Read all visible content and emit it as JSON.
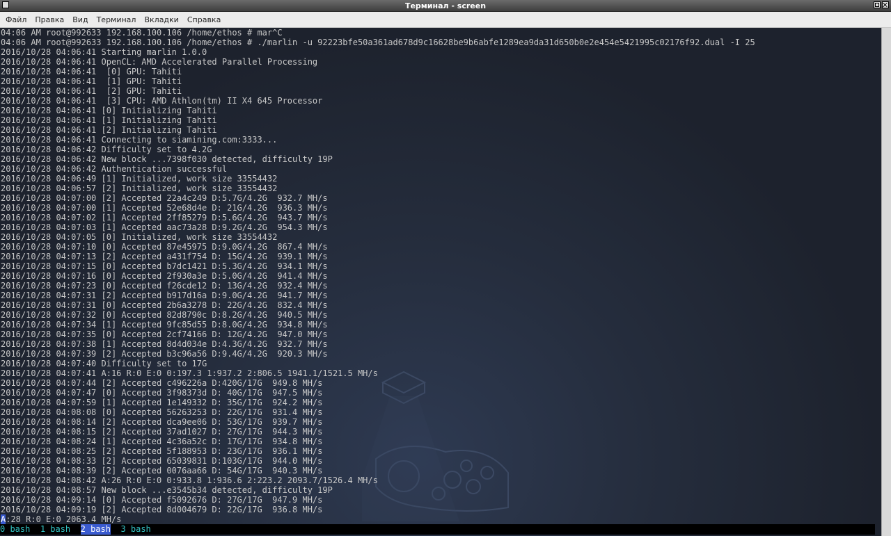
{
  "window": {
    "title": "Терминал - screen"
  },
  "menu": [
    "Файл",
    "Правка",
    "Вид",
    "Терминал",
    "Вкладки",
    "Справка"
  ],
  "terminal": {
    "lines": [
      "04:06 AM root@992633 192.168.100.106 /home/ethos # mar^C",
      "04:06 AM root@992633 192.168.100.106 /home/ethos # ./marlin -u 92223bfe50a361ad678d9c16628be9b6abfe1289ea9da31d650b0e2e454e5421995c02176f92.dual -I 25",
      "2016/10/28 04:06:41 Starting marlin 1.0.0",
      "2016/10/28 04:06:41 OpenCL: AMD Accelerated Parallel Processing",
      "2016/10/28 04:06:41  [0] GPU: Tahiti",
      "2016/10/28 04:06:41  [1] GPU: Tahiti",
      "2016/10/28 04:06:41  [2] GPU: Tahiti",
      "2016/10/28 04:06:41  [3] CPU: AMD Athlon(tm) II X4 645 Processor",
      "2016/10/28 04:06:41 [0] Initializing Tahiti",
      "2016/10/28 04:06:41 [1] Initializing Tahiti",
      "2016/10/28 04:06:41 [2] Initializing Tahiti",
      "2016/10/28 04:06:41 Connecting to siamining.com:3333...",
      "2016/10/28 04:06:42 Difficulty set to 4.2G",
      "2016/10/28 04:06:42 New block ...7398f030 detected, difficulty 19P",
      "2016/10/28 04:06:42 Authentication successful",
      "2016/10/28 04:06:49 [1] Initialized, work size 33554432",
      "2016/10/28 04:06:57 [2] Initialized, work size 33554432",
      "2016/10/28 04:07:00 [2] Accepted 22a4c249 D:5.7G/4.2G  932.7 MH/s",
      "2016/10/28 04:07:00 [1] Accepted 52e68d4e D: 21G/4.2G  936.3 MH/s",
      "2016/10/28 04:07:02 [1] Accepted 2ff85279 D:5.6G/4.2G  943.7 MH/s",
      "2016/10/28 04:07:03 [1] Accepted aac73a28 D:9.2G/4.2G  954.3 MH/s",
      "2016/10/28 04:07:05 [0] Initialized, work size 33554432",
      "2016/10/28 04:07:10 [0] Accepted 87e45975 D:9.0G/4.2G  867.4 MH/s",
      "2016/10/28 04:07:13 [2] Accepted a431f754 D: 15G/4.2G  939.1 MH/s",
      "2016/10/28 04:07:15 [0] Accepted b7dc1421 D:5.3G/4.2G  934.1 MH/s",
      "2016/10/28 04:07:16 [0] Accepted 2f930a3e D:5.0G/4.2G  941.4 MH/s",
      "2016/10/28 04:07:23 [0] Accepted f26cde12 D: 13G/4.2G  932.4 MH/s",
      "2016/10/28 04:07:31 [2] Accepted b917d16a D:9.0G/4.2G  941.7 MH/s",
      "2016/10/28 04:07:31 [0] Accepted 2b6a3278 D: 22G/4.2G  832.4 MH/s",
      "2016/10/28 04:07:32 [0] Accepted 82d8790c D:8.2G/4.2G  940.5 MH/s",
      "2016/10/28 04:07:34 [1] Accepted 9fc85d55 D:8.0G/4.2G  934.8 MH/s",
      "2016/10/28 04:07:35 [0] Accepted 2cf74166 D: 12G/4.2G  947.0 MH/s",
      "2016/10/28 04:07:38 [1] Accepted 8d4d034e D:4.3G/4.2G  932.7 MH/s",
      "2016/10/28 04:07:39 [2] Accepted b3c96a56 D:9.4G/4.2G  920.3 MH/s",
      "2016/10/28 04:07:40 Difficulty set to 17G",
      "2016/10/28 04:07:41 A:16 R:0 E:0 0:197.3 1:937.2 2:806.5 1941.1/1521.5 MH/s",
      "2016/10/28 04:07:44 [2] Accepted c496226a D:420G/17G  949.8 MH/s",
      "2016/10/28 04:07:47 [0] Accepted 3f98373d D: 40G/17G  947.5 MH/s",
      "2016/10/28 04:07:59 [1] Accepted 1e149332 D: 35G/17G  924.2 MH/s",
      "2016/10/28 04:08:08 [0] Accepted 56263253 D: 22G/17G  931.4 MH/s",
      "2016/10/28 04:08:14 [2] Accepted dca9ee06 D: 53G/17G  939.7 MH/s",
      "2016/10/28 04:08:15 [2] Accepted 37ad1027 D: 27G/17G  944.3 MH/s",
      "2016/10/28 04:08:24 [1] Accepted 4c36a52c D: 17G/17G  934.8 MH/s",
      "2016/10/28 04:08:25 [2] Accepted 5f188953 D: 23G/17G  936.1 MH/s",
      "2016/10/28 04:08:33 [2] Accepted 65039831 D:103G/17G  944.0 MH/s",
      "2016/10/28 04:08:39 [2] Accepted 0076aa66 D: 54G/17G  940.3 MH/s",
      "2016/10/28 04:08:42 A:26 R:0 E:0 0:933.8 1:936.6 2:223.2 2093.7/1526.4 MH/s",
      "2016/10/28 04:08:57 New block ...e3545b34 detected, difficulty 19P",
      "2016/10/28 04:09:14 [0] Accepted f5092676 D: 27G/17G  947.9 MH/s",
      "2016/10/28 04:09:19 [2] Accepted 8d004679 D: 22G/17G  936.8 MH/s"
    ],
    "status_cursor_char": "A",
    "status_rest": ":28 R:0 E:0 2063.4 MH/s"
  },
  "screen_tabs": [
    {
      "label": "0 bash",
      "active": false
    },
    {
      "label": "1 bash",
      "active": false
    },
    {
      "label": "2 bash",
      "active": true
    },
    {
      "label": "3 bash",
      "active": false
    }
  ],
  "colors": {
    "tab_active_bg": "#3a5bd0",
    "tab_text": "#33c5c5",
    "text": "#c8c8c8"
  }
}
